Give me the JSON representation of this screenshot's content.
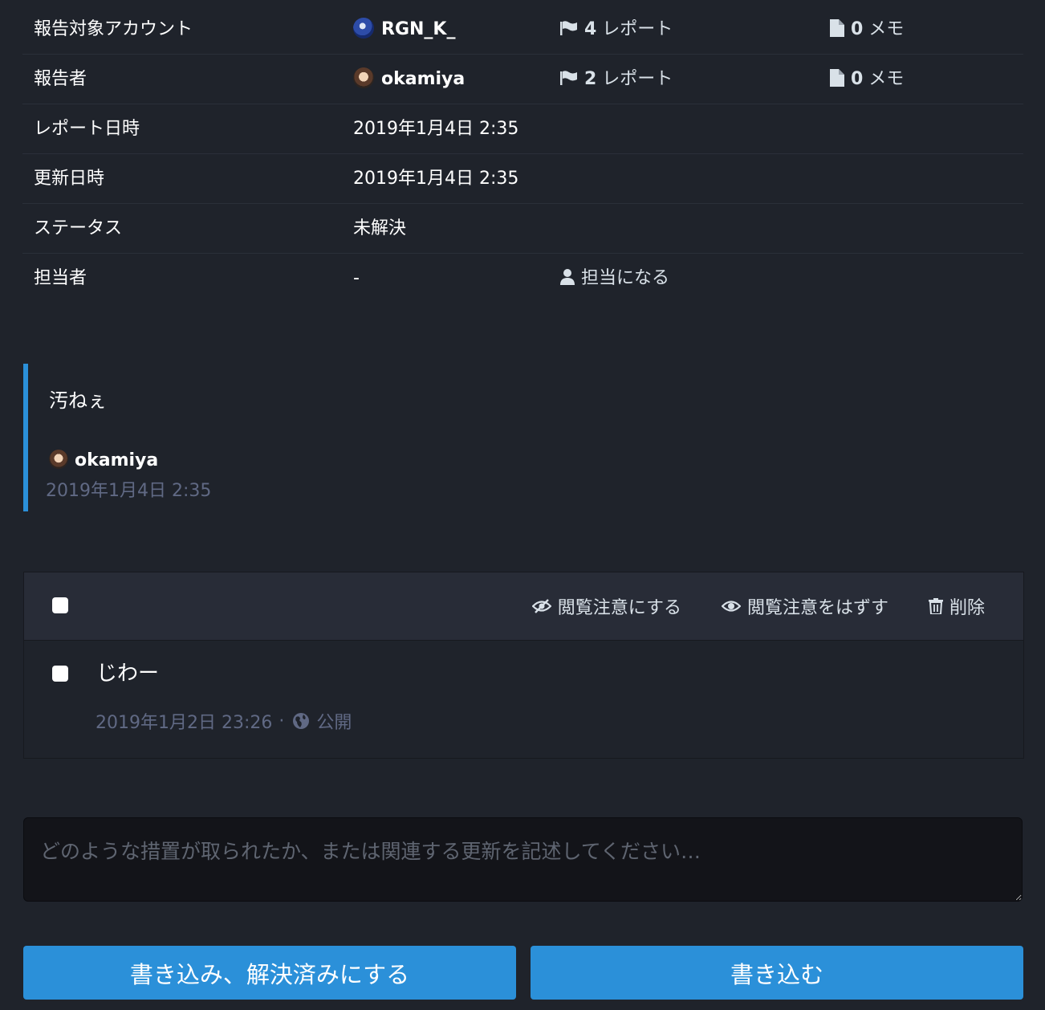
{
  "info": {
    "target_label": "報告対象アカウント",
    "target_account": "RGN_K_",
    "target_reports_count": "4",
    "target_reports_unit": " レポート",
    "target_memos_count": "0",
    "target_memos_unit": " メモ",
    "reporter_label": "報告者",
    "reporter_account": "okamiya",
    "reporter_reports_count": "2",
    "reporter_reports_unit": " レポート",
    "reporter_memos_count": "0",
    "reporter_memos_unit": " メモ",
    "reported_at_label": "レポート日時",
    "reported_at": "2019年1月4日 2:35",
    "updated_at_label": "更新日時",
    "updated_at": "2019年1月4日 2:35",
    "status_label": "ステータス",
    "status": "未解決",
    "assignee_label": "担当者",
    "assignee": "-",
    "assign_to_self": "担当になる"
  },
  "report_comment": {
    "text": "汚ねぇ",
    "author": "okamiya",
    "time": "2019年1月4日 2:35"
  },
  "batch": {
    "mark_sensitive": "閲覧注意にする",
    "unmark_sensitive": "閲覧注意をはずす",
    "delete": "削除"
  },
  "statuses": [
    {
      "text": "じわー",
      "time": "2019年1月2日 23:26",
      "separator": "·",
      "visibility": "公開"
    }
  ],
  "note": {
    "placeholder": "どのような措置が取られたか、または関連する更新を記述してください…"
  },
  "buttons": {
    "resolve": "書き込み、解決済みにする",
    "comment": "書き込む"
  },
  "colors": {
    "background": "#1f232b",
    "accent": "#2b90d9",
    "muted": "#606984"
  },
  "icons": [
    "flag-icon",
    "file-icon",
    "user-icon",
    "eye-slash-icon",
    "eye-icon",
    "trash-icon",
    "globe-icon"
  ]
}
